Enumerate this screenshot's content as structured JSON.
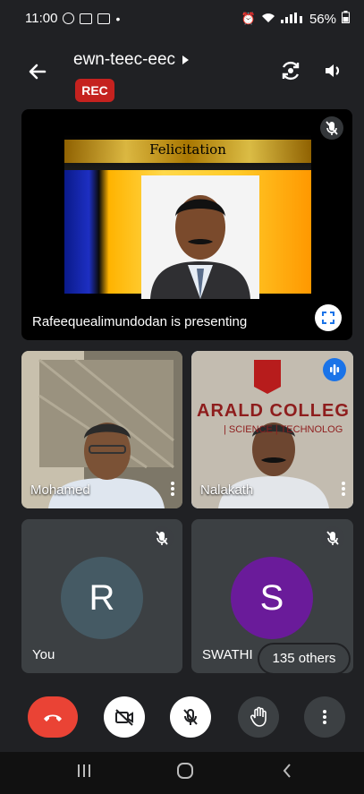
{
  "status_bar": {
    "time": "11:00",
    "dot": "•",
    "battery": "56%"
  },
  "header": {
    "meeting_code": "ewn-teec-eec",
    "rec_badge": "REC"
  },
  "presentation": {
    "slide_title": "Felicitation",
    "presenter_label": "Rafeequealimundodan is presenting"
  },
  "participants": [
    {
      "name": "Mohamed"
    },
    {
      "name": "Nalakath",
      "college_banner": "ARALD COLLEG",
      "banner_sub": "| SCIENCE | TECHNOLOG"
    },
    {
      "name": "You",
      "initial": "R",
      "avatar_color": "#455a64"
    },
    {
      "name": "SWATHI",
      "initial": "S",
      "avatar_color": "#6a1b9a"
    }
  ],
  "others_chip": "135 others",
  "colors": {
    "background": "#202124",
    "end_call": "#ea4335",
    "rec": "#c5221f",
    "active_speaker": "#1a73e8"
  }
}
